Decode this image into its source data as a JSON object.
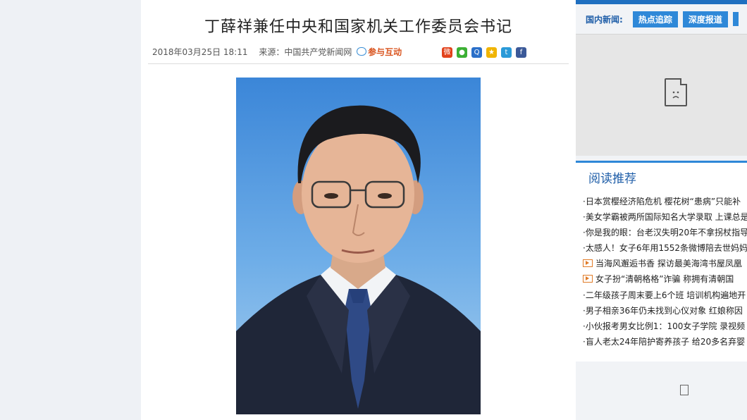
{
  "article": {
    "title": "丁薛祥兼任中央和国家机关工作委员会书记",
    "date": "2018年03月25日 18:11",
    "source": "来源：中国共产党新闻网",
    "interact_label": "参与互动"
  },
  "share_icons": [
    {
      "name": "weibo-share-icon",
      "color": "#e2421b",
      "glyph": "微"
    },
    {
      "name": "wechat-share-icon",
      "color": "#3cb034",
      "glyph": "●"
    },
    {
      "name": "qq-share-icon",
      "color": "#2a6fc9",
      "glyph": "Q"
    },
    {
      "name": "qzone-share-icon",
      "color": "#f0b400",
      "glyph": "★"
    },
    {
      "name": "tencent-weibo-share-icon",
      "color": "#2a9ad8",
      "glyph": "t"
    },
    {
      "name": "facebook-share-icon",
      "color": "#3b5998",
      "glyph": "f"
    }
  ],
  "sidebar": {
    "news_label": "国内新闻:",
    "tabs": [
      "热点追踪",
      "深度报道"
    ],
    "recommend_title": "阅读推荐",
    "items": [
      {
        "text": "·日本赏樱经济陷危机 樱花树“患病”只能补",
        "video": false
      },
      {
        "text": "·美女学霸被两所国际知名大学录取 上课总是",
        "video": false
      },
      {
        "text": "·你是我的眼：台老汉失明20年不拿拐杖指导",
        "video": false
      },
      {
        "text": "·太感人！女子6年用1552条微博陪去世妈妈",
        "video": false
      },
      {
        "text": "当海风邂逅书香 探访最美海湾书屋凤凰",
        "video": true
      },
      {
        "text": "女子扮“清朝格格”诈骗 称拥有清朝国",
        "video": true
      },
      {
        "text": "·二年级孩子周末要上6个班 培训机构遍地开",
        "video": false
      },
      {
        "text": "·男子相亲36年仍未找到心仪对象 红娘称因",
        "video": false
      },
      {
        "text": "·小伙报考男女比例1：100女子学院 录视频",
        "video": false
      },
      {
        "text": "·盲人老太24年陪护寄养孩子 给20多名弃婴",
        "video": false
      }
    ]
  }
}
